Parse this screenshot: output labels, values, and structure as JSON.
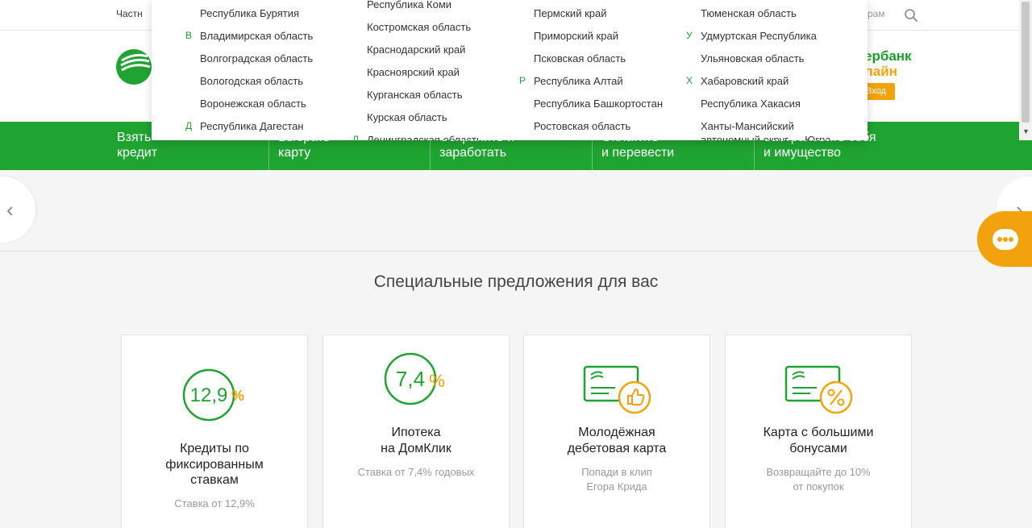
{
  "topbar": {
    "nav_left": "Частн",
    "nav_right": "рам"
  },
  "header": {
    "online_line1": "ербанк",
    "online_line2": "лайн",
    "login": "Вход"
  },
  "greennav": [
    {
      "l1": "Взять",
      "l2": "кредит"
    },
    {
      "l1": "Выбрать",
      "l2": "карту"
    },
    {
      "l1": "Сохранить и",
      "l2": "заработать"
    },
    {
      "l1": "Оплатить",
      "l2": "и перевести"
    },
    {
      "l1": "Застраховать себя",
      "l2": "и имущество"
    }
  ],
  "carousel": {
    "prev": "‹",
    "next": "›"
  },
  "section_title": "Специальные предложения для вас",
  "cards": [
    {
      "rate": "12,9",
      "unit": "%",
      "title": [
        "Кредиты по",
        "фиксированным",
        "ставкам"
      ],
      "sub": [
        "Ставка от 12,9%"
      ]
    },
    {
      "rate": "7,4",
      "unit": "%",
      "title": [
        "Ипотека",
        "на ДомКлик"
      ],
      "sub": [
        "Ставка от 7,4% годовых"
      ]
    },
    {
      "title": [
        "Молодёжная",
        "дебетовая карта"
      ],
      "sub": [
        "Попади в клип",
        "Егора Крида"
      ]
    },
    {
      "title": [
        "Карта с большими",
        "бонусами"
      ],
      "sub": [
        "Возвращайте до 10%",
        "от покупок"
      ]
    }
  ],
  "regions": {
    "col1": [
      {
        "letter": "",
        "name": "Республика Бурятия"
      },
      {
        "letter": "В",
        "name": "Владимирская область"
      },
      {
        "letter": "",
        "name": "Волгоградская область"
      },
      {
        "letter": "",
        "name": "Вологодская область"
      },
      {
        "letter": "",
        "name": "Воронежская область"
      },
      {
        "letter": "Д",
        "name": "Республика Дагестан"
      }
    ],
    "col2": [
      {
        "letter": "",
        "name": "Республика Коми"
      },
      {
        "letter": "",
        "name": "Костромская область"
      },
      {
        "letter": "",
        "name": "Краснодарский край"
      },
      {
        "letter": "",
        "name": "Красноярский край"
      },
      {
        "letter": "",
        "name": "Курганская область"
      },
      {
        "letter": "",
        "name": "Курская область"
      },
      {
        "letter": "Л",
        "name": "Ленинградская область"
      }
    ],
    "col3": [
      {
        "letter": "",
        "name": "Пермский край"
      },
      {
        "letter": "",
        "name": "Приморский край"
      },
      {
        "letter": "",
        "name": "Псковская область"
      },
      {
        "letter": "Р",
        "name": "Республика Алтай"
      },
      {
        "letter": "",
        "name": "Республика Башкортостан"
      },
      {
        "letter": "",
        "name": "Ростовская область"
      }
    ],
    "col4": [
      {
        "letter": "",
        "name": "Тюменская область"
      },
      {
        "letter": "У",
        "name": "Удмуртская Республика"
      },
      {
        "letter": "",
        "name": "Ульяновская область"
      },
      {
        "letter": "Х",
        "name": "Хабаровский край"
      },
      {
        "letter": "",
        "name": "Республика Хакасия"
      },
      {
        "letter": "",
        "name": "Ханты-Мансийский"
      },
      {
        "letter": "",
        "name": "автономный округ — Югра"
      }
    ]
  },
  "colors": {
    "green": "#1fa331",
    "orange": "#f2a20c"
  },
  "icons": [
    "search-icon",
    "sber-logo-icon",
    "chat-icon",
    "rate-circle-icon",
    "card-like-icon",
    "card-percent-icon",
    "chevron-left-icon",
    "chevron-right-icon"
  ]
}
